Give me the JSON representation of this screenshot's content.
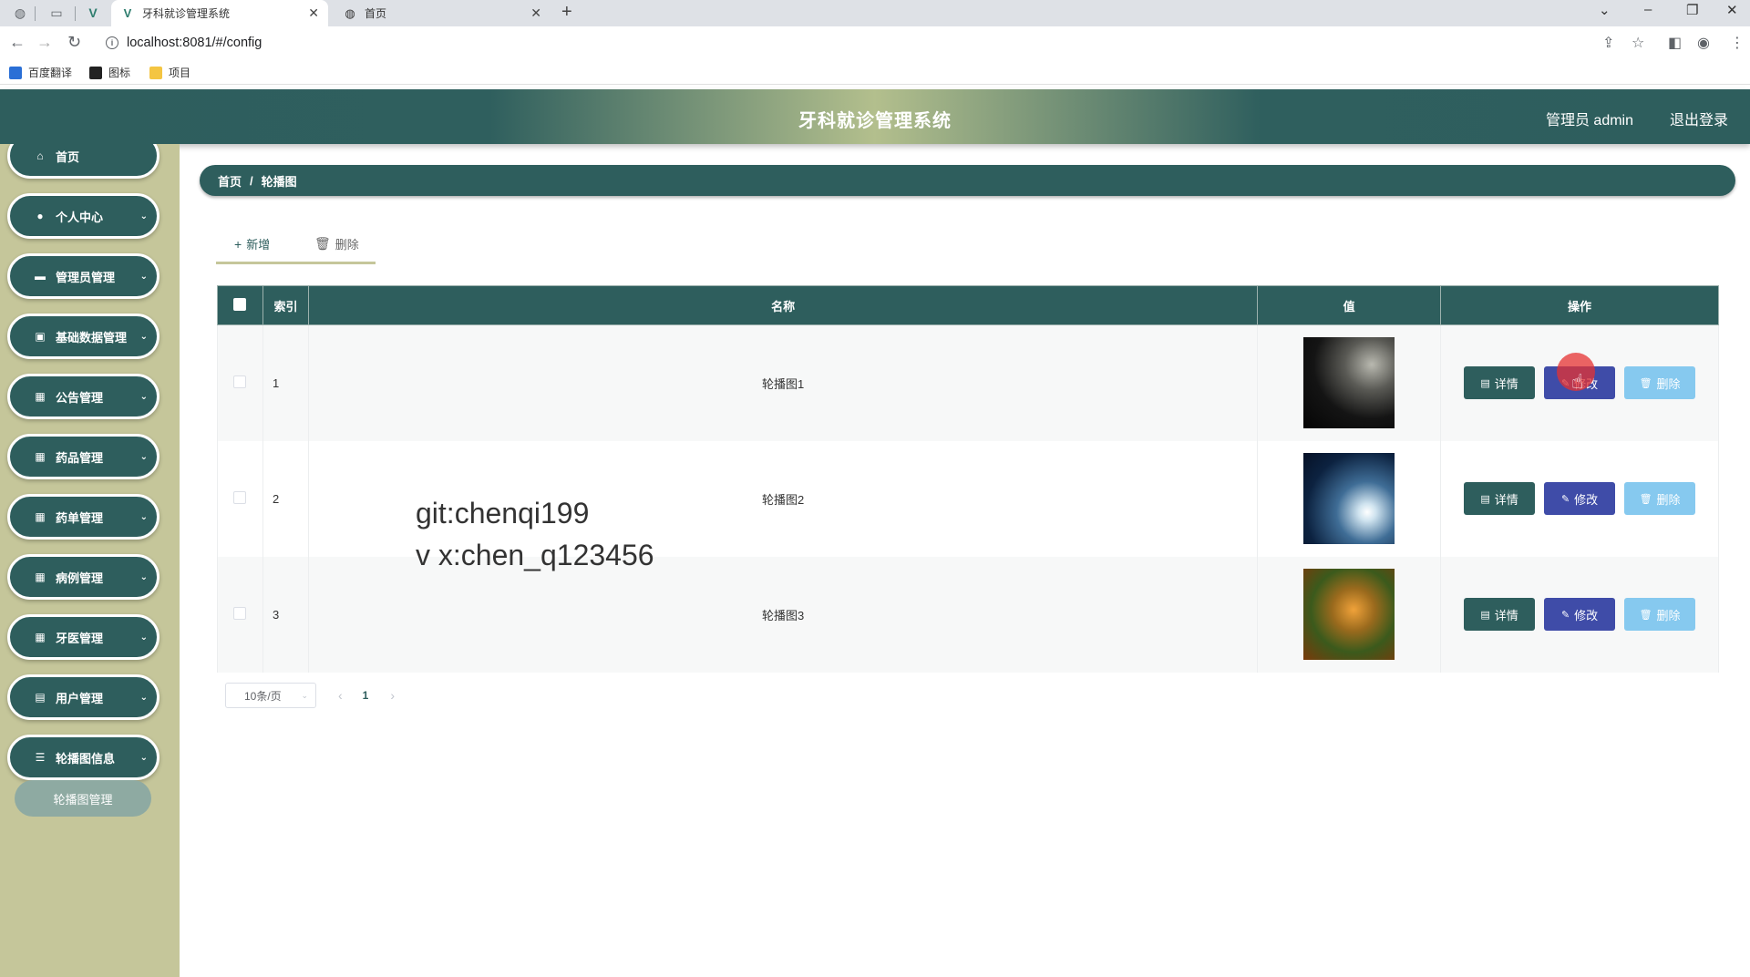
{
  "browser": {
    "tabs": [
      {
        "title": "牙科就诊管理系统",
        "active": true
      },
      {
        "title": "首页",
        "active": false
      }
    ],
    "url": "localhost:8081/#/config",
    "bookmarks": [
      "百度翻译",
      "图标",
      "项目"
    ]
  },
  "app": {
    "title": "牙科就诊管理系统",
    "user": "管理员 admin",
    "logout": "退出登录"
  },
  "sidebar": {
    "items": [
      {
        "label": "首页",
        "icon": "home-icon",
        "glyph": "⌂",
        "has_chevron": false
      },
      {
        "label": "个人中心",
        "icon": "user-icon",
        "glyph": "●",
        "has_chevron": true
      },
      {
        "label": "管理员管理",
        "icon": "monitor-icon",
        "glyph": "▬",
        "has_chevron": true
      },
      {
        "label": "基础数据管理",
        "icon": "checkbox-icon",
        "glyph": "▣",
        "has_chevron": true
      },
      {
        "label": "公告管理",
        "icon": "grid-icon",
        "glyph": "▦",
        "has_chevron": true
      },
      {
        "label": "药品管理",
        "icon": "grid-icon",
        "glyph": "▦",
        "has_chevron": true
      },
      {
        "label": "药单管理",
        "icon": "grid-icon",
        "glyph": "▦",
        "has_chevron": true
      },
      {
        "label": "病例管理",
        "icon": "grid-icon",
        "glyph": "▦",
        "has_chevron": true
      },
      {
        "label": "牙医管理",
        "icon": "grid-icon",
        "glyph": "▦",
        "has_chevron": true
      },
      {
        "label": "用户管理",
        "icon": "clipboard-icon",
        "glyph": "▤",
        "has_chevron": true
      },
      {
        "label": "轮播图信息",
        "icon": "list-icon",
        "glyph": "☰",
        "has_chevron": true
      }
    ],
    "submenu": "轮播图管理"
  },
  "breadcrumb": {
    "home": "首页",
    "separator": "/",
    "current": "轮播图"
  },
  "toolbar": {
    "add": "新增",
    "delete": "删除"
  },
  "table": {
    "headers": [
      "索引",
      "名称",
      "值",
      "操作"
    ],
    "rows": [
      {
        "index": "1",
        "name": "轮播图1",
        "image": "thumb1"
      },
      {
        "index": "2",
        "name": "轮播图2",
        "image": "thumb2"
      },
      {
        "index": "3",
        "name": "轮播图3",
        "image": "thumb3"
      }
    ],
    "actions": {
      "detail": "详情",
      "edit": "修改",
      "delete": "删除"
    }
  },
  "pagination": {
    "page_size": "10条/页",
    "current_page": "1"
  },
  "watermark": {
    "line1": "git:chenqi199",
    "line2": "v x:chen_q123456"
  },
  "colors": {
    "primary": "#2e5e5d",
    "sidebar_bg": "#c5c69a",
    "edit": "#3f4ca8",
    "delete": "#86c9ef"
  }
}
